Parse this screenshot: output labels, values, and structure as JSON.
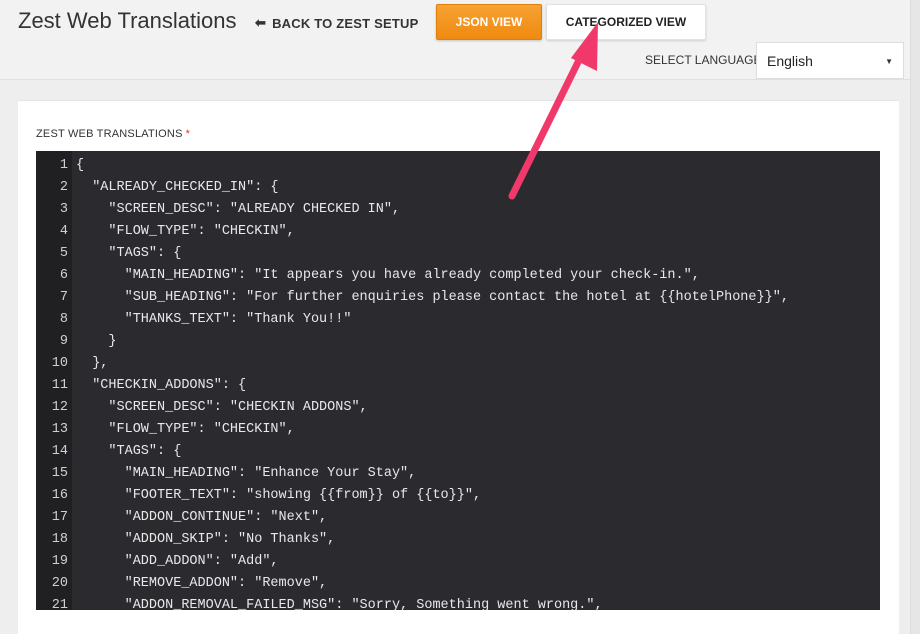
{
  "header": {
    "title": "Zest Web Translations",
    "back_link": "BACK TO ZEST SETUP",
    "back_icon": "left-arrow-icon",
    "json_view": "JSON VIEW",
    "categorized_view": "CATEGORIZED VIEW"
  },
  "language": {
    "label": "SELECT LANGUAGE",
    "selected": "English"
  },
  "field": {
    "label": "ZEST WEB TRANSLATIONS",
    "required_mark": "*"
  },
  "editor": {
    "lines": [
      {
        "n": "1",
        "code": "{"
      },
      {
        "n": "2",
        "code": "  \"ALREADY_CHECKED_IN\": {"
      },
      {
        "n": "3",
        "code": "    \"SCREEN_DESC\": \"ALREADY CHECKED IN\","
      },
      {
        "n": "4",
        "code": "    \"FLOW_TYPE\": \"CHECKIN\","
      },
      {
        "n": "5",
        "code": "    \"TAGS\": {"
      },
      {
        "n": "6",
        "code": "      \"MAIN_HEADING\": \"It appears you have already completed your check-in.\","
      },
      {
        "n": "7",
        "code": "      \"SUB_HEADING\": \"For further enquiries please contact the hotel at {{hotelPhone}}\","
      },
      {
        "n": "8",
        "code": "      \"THANKS_TEXT\": \"Thank You!!\""
      },
      {
        "n": "9",
        "code": "    }"
      },
      {
        "n": "10",
        "code": "  },"
      },
      {
        "n": "11",
        "code": "  \"CHECKIN_ADDONS\": {"
      },
      {
        "n": "12",
        "code": "    \"SCREEN_DESC\": \"CHECKIN ADDONS\","
      },
      {
        "n": "13",
        "code": "    \"FLOW_TYPE\": \"CHECKIN\","
      },
      {
        "n": "14",
        "code": "    \"TAGS\": {"
      },
      {
        "n": "15",
        "code": "      \"MAIN_HEADING\": \"Enhance Your Stay\","
      },
      {
        "n": "16",
        "code": "      \"FOOTER_TEXT\": \"showing {{from}} of {{to}}\","
      },
      {
        "n": "17",
        "code": "      \"ADDON_CONTINUE\": \"Next\","
      },
      {
        "n": "18",
        "code": "      \"ADDON_SKIP\": \"No Thanks\","
      },
      {
        "n": "19",
        "code": "      \"ADD_ADDON\": \"Add\","
      },
      {
        "n": "20",
        "code": "      \"REMOVE_ADDON\": \"Remove\","
      },
      {
        "n": "21",
        "code": "      \"ADDON_REMOVAL_FAILED_MSG\": \"Sorry, Something went wrong.\","
      }
    ]
  },
  "colors": {
    "accent_orange": "#ef8a10",
    "annotation_arrow": "#f0386b",
    "editor_bg": "#2b2b2f",
    "required": "#d9342b"
  }
}
